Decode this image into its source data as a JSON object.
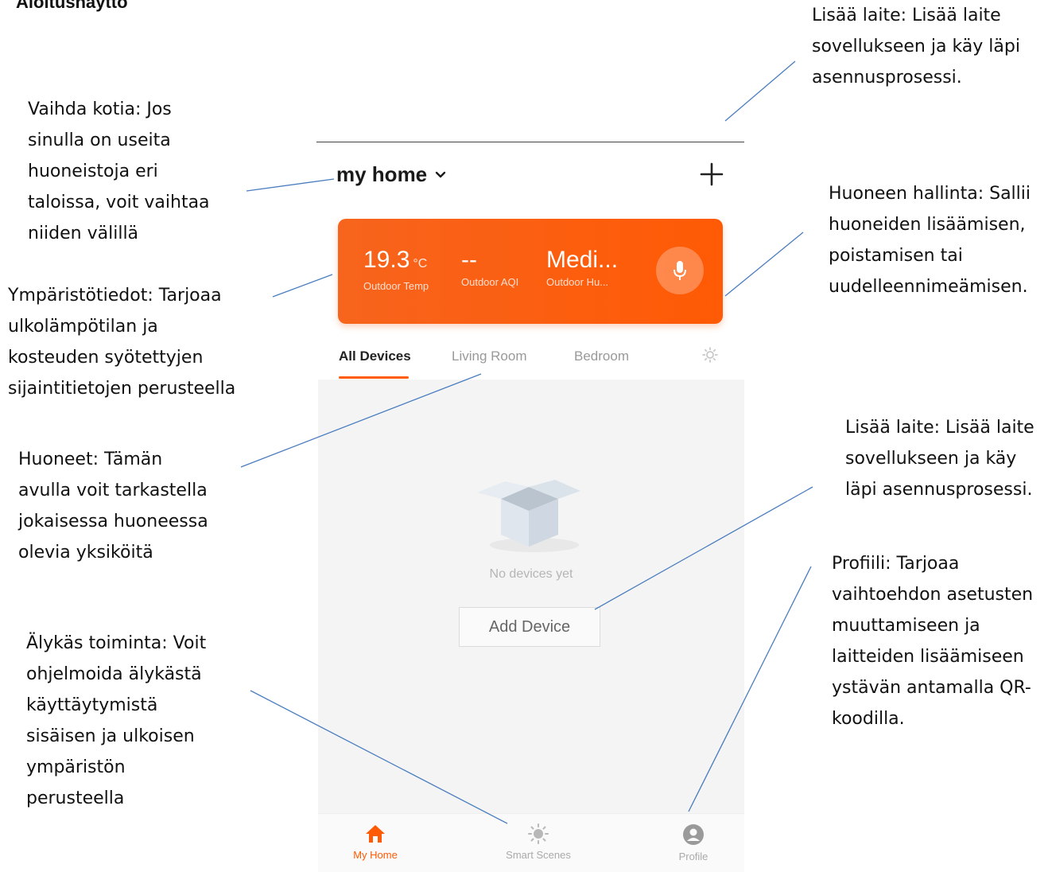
{
  "heading": "Aloitusnäyttö",
  "annotations": {
    "add_device_top": "Lisää laite: Lisää laite\nsovellukseen ja käy läpi\nasennusprosessi.",
    "switch_home": "Vaihda kotia: Jos\nsinulla on useita\nhuoneistoja eri\ntaloissa, voit vaihtaa\nniiden välillä",
    "room_management": "Huoneen hallinta: Sallii\nhuoneiden lisäämisen,\npoistamisen tai\nuudelleennimeämisen.",
    "environment": "Ympäristötiedot: Tarjoaa\nulkolämpötilan ja\nkosteuden syötettyjen\nsijaintitietojen perusteella",
    "rooms": "Huoneet: Tämän\navulla voit tarkastella\njokaisessa huoneessa\nolevia yksiköitä",
    "add_device_mid": "Lisää laite: Lisää laite\nsovellukseen ja käy\nläpi asennusprosessi.",
    "profile": "Profiili: Tarjoaa\nvaihtoehdon asetusten\nmuuttamiseen ja\nlaitteiden lisäämiseen\nystävän antamalla QR-\nkoodilla.",
    "smart_action": "Älykäs toiminta: Voit\nohjelmoida älykästä\nkäyttäytymistä\nsisäisen ja ulkoisen\nympäristön\nperusteella"
  },
  "app": {
    "home_name": "my home",
    "home_dropdown_icon": "chevron-down-icon",
    "add_icon": "plus-icon",
    "environment": {
      "temperature": {
        "value": "19.3",
        "unit": "°C",
        "label": "Outdoor Temp"
      },
      "aqi": {
        "value": "--",
        "label": "Outdoor AQI"
      },
      "humidity": {
        "value": "Medi...",
        "label": "Outdoor Hu..."
      },
      "mic_icon": "microphone-icon"
    },
    "tabs": [
      {
        "label": "All Devices",
        "active": true
      },
      {
        "label": "Living Room",
        "active": false
      },
      {
        "label": "Bedroom",
        "active": false
      }
    ],
    "room_settings_icon": "gear-icon",
    "empty_state": {
      "icon": "empty-box-icon",
      "message": "No devices yet",
      "button_label": "Add Device"
    },
    "bottom_nav": [
      {
        "label": "My Home",
        "icon": "home-icon",
        "active": true
      },
      {
        "label": "Smart Scenes",
        "icon": "sun-icon",
        "active": false
      },
      {
        "label": "Profile",
        "icon": "profile-icon",
        "active": false
      }
    ],
    "colors": {
      "accent": "#ff5a05",
      "content_bg": "#f4f4f4",
      "muted_text": "#999999"
    }
  }
}
